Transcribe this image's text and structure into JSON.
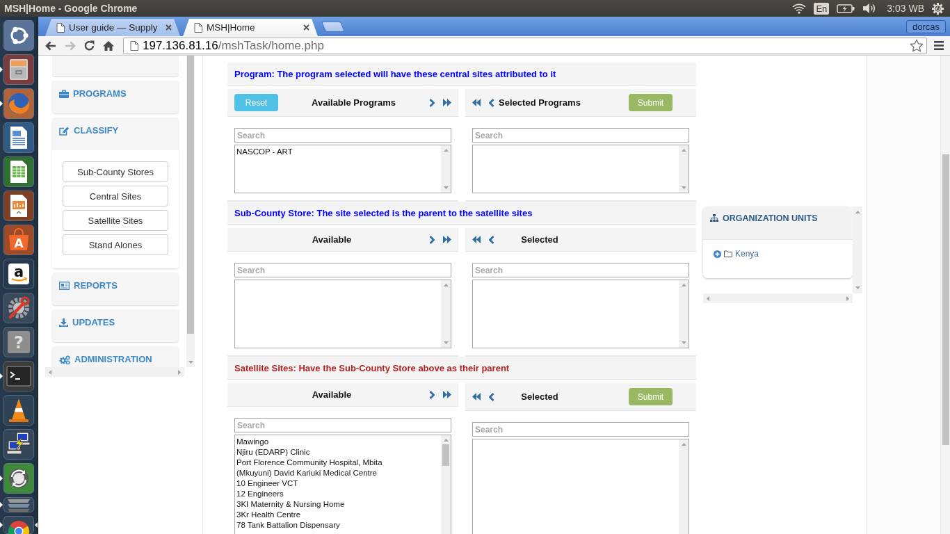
{
  "system_bar": {
    "title": "MSH|Home - Google Chrome",
    "keyboard_layout": "En",
    "clock": "3:03 WB"
  },
  "launcher": {
    "items": [
      {
        "kind": "dash",
        "running": false,
        "focused": false
      },
      {
        "kind": "files",
        "running": true,
        "focused": false
      },
      {
        "kind": "globe",
        "running": true,
        "focused": false
      },
      {
        "kind": "writer",
        "running": false,
        "focused": false
      },
      {
        "kind": "calc",
        "running": false,
        "focused": false
      },
      {
        "kind": "impress",
        "running": false,
        "focused": false
      },
      {
        "kind": "store",
        "running": false,
        "focused": false,
        "glyph": "A"
      },
      {
        "kind": "shop",
        "running": false,
        "focused": false,
        "glyph": "a"
      },
      {
        "kind": "settings",
        "running": false,
        "focused": false
      },
      {
        "kind": "help",
        "running": false,
        "focused": false,
        "glyph": "?"
      },
      {
        "kind": "terminal",
        "running": true,
        "focused": false
      },
      {
        "kind": "cone",
        "running": false,
        "focused": false
      },
      {
        "kind": "remote",
        "running": false,
        "focused": false
      },
      {
        "kind": "updater",
        "running": true,
        "focused": false
      },
      {
        "kind": "stack",
        "running": true,
        "focused": false
      },
      {
        "kind": "browser",
        "running": true,
        "focused": true
      }
    ]
  },
  "browser": {
    "tabs": [
      {
        "title": "User guide — Supply",
        "selected": false
      },
      {
        "title": "MSH|Home",
        "selected": true
      }
    ],
    "profile": "dorcas",
    "nav_buttons": [
      {
        "kind": "back",
        "disabled": false
      },
      {
        "kind": "forward",
        "disabled": true
      },
      {
        "kind": "reload",
        "disabled": false
      },
      {
        "kind": "home",
        "disabled": false
      }
    ],
    "address": {
      "host": "197.136.81.16",
      "path": "/mshTask/home.php"
    }
  },
  "sidebar": {
    "items": [
      {
        "kind": "programs",
        "label": "PROGRAMS",
        "expanded": false
      },
      {
        "kind": "classify",
        "label": "CLASSIFY",
        "expanded": true,
        "children": [
          {
            "label": "Sub-County Stores"
          },
          {
            "label": "Central Sites"
          },
          {
            "label": "Satellite Sites"
          },
          {
            "label": "Stand Alones"
          }
        ]
      },
      {
        "kind": "reports",
        "label": "REPORTS",
        "expanded": false
      },
      {
        "kind": "updates",
        "label": "UPDATES",
        "expanded": false
      },
      {
        "kind": "administration",
        "label": "ADMINISTRATION",
        "expanded": false
      }
    ]
  },
  "sections": [
    {
      "heading": "Program: The program selected will have these central sites attributed to it",
      "color": "#0000ff",
      "available": {
        "title": "Available Programs",
        "button": {
          "kind": "reset",
          "label": "Reset"
        },
        "search_placeholder": "Search",
        "items": [
          "NASCOP - ART"
        ]
      },
      "selected": {
        "title": "Selected Programs",
        "button": {
          "kind": "submit",
          "label": "Submit"
        },
        "search_placeholder": "Search"
      }
    },
    {
      "heading": "Sub-County Store: The site selected is the parent to the satellite sites",
      "color": "#0000ff",
      "available": {
        "title": "Available",
        "search_placeholder": "Search"
      },
      "selected": {
        "title": "Selected",
        "search_placeholder": "Search"
      }
    },
    {
      "heading": "Satellite Sites: Have the Sub-County Store above as their parent",
      "color": "#b22222",
      "available": {
        "title": "Available",
        "search_placeholder": "Search",
        "items": [
          "Mawingo",
          "Njiru (EDARP) Clinic",
          "Port Florence Community Hospital, Mbita",
          "(Mkuyuni) David Kariuki Medical Centre",
          "10 Engineer VCT",
          "12 Engineers",
          "3KI Maternity & Nursing Home",
          "3Kr Health Centre",
          "78 Tank Battalion Dispensary"
        ]
      },
      "selected": {
        "title": "Selected",
        "button": {
          "kind": "submit",
          "label": "Submit"
        },
        "search_placeholder": "Search"
      }
    }
  ],
  "org_units": {
    "title": "ORGANIZATION UNITS",
    "tree": [
      {
        "label": "Kenya",
        "expanded": false
      }
    ]
  }
}
